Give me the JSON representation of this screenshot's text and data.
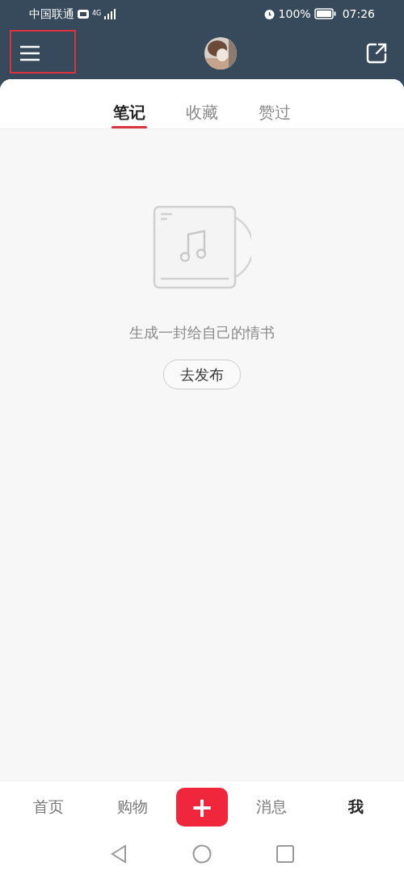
{
  "status_bar": {
    "carrier": "中国联通",
    "network": "4G",
    "battery": "100%",
    "time": "07:26"
  },
  "header": {
    "highlight_menu": true
  },
  "tabs": [
    {
      "label": "笔记",
      "selected": true
    },
    {
      "label": "收藏",
      "selected": false
    },
    {
      "label": "赞过",
      "selected": false
    }
  ],
  "empty_state": {
    "message": "生成一封给自己的情书",
    "button": "去发布"
  },
  "bottom_nav": [
    {
      "kind": "tab",
      "label": "首页",
      "selected": false
    },
    {
      "kind": "tab",
      "label": "购物",
      "selected": false
    },
    {
      "kind": "add",
      "label": "+"
    },
    {
      "kind": "tab",
      "label": "消息",
      "selected": false
    },
    {
      "kind": "tab",
      "label": "我",
      "selected": true
    }
  ]
}
